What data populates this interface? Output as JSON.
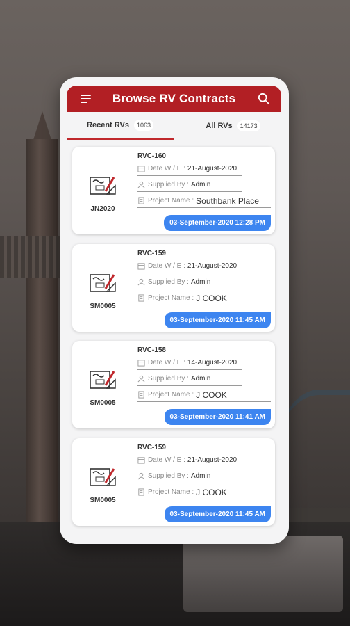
{
  "app": {
    "title": "Browse RV Contracts",
    "accent": "#b21f24",
    "badge_color": "#3d85f0"
  },
  "tabs": [
    {
      "label": "Recent RVs",
      "count": "1063",
      "active": true
    },
    {
      "label": "All RVs",
      "count": "14173",
      "active": false
    }
  ],
  "labels": {
    "date": "Date W / E :",
    "supplied": "Supplied By :",
    "project": "Project Name :"
  },
  "cards": [
    {
      "id": "RVC-160",
      "code": "JN2020",
      "date": "21-August-2020",
      "supplied_by": "Admin",
      "project": "Southbank Place",
      "timestamp": "03-September-2020 12:28 PM"
    },
    {
      "id": "RVC-159",
      "code": "SM0005",
      "date": "21-August-2020",
      "supplied_by": "Admin",
      "project": "J COOK",
      "timestamp": "03-September-2020 11:45 AM"
    },
    {
      "id": "RVC-158",
      "code": "SM0005",
      "date": "14-August-2020",
      "supplied_by": "Admin",
      "project": "J COOK",
      "timestamp": "03-September-2020 11:41 AM"
    },
    {
      "id": "RVC-159",
      "code": "SM0005",
      "date": "21-August-2020",
      "supplied_by": "Admin",
      "project": "J COOK",
      "timestamp": "03-September-2020 11:45 AM"
    }
  ],
  "icons": {
    "menu": "hamburger-menu-icon",
    "search": "search-icon",
    "document": "signed-document-icon",
    "calendar": "calendar-icon",
    "user": "user-icon",
    "building": "building-icon"
  }
}
